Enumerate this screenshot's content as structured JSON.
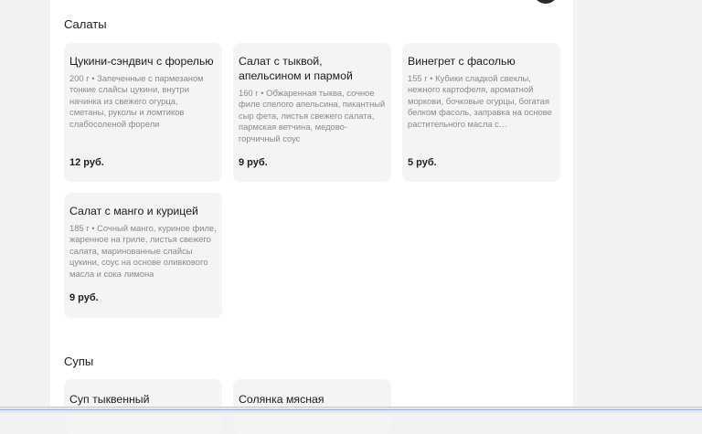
{
  "sections": [
    {
      "title": "Салаты",
      "items": [
        {
          "name": "Цукини-сэндвич с форелью",
          "desc": "200 г • Запеченные с пармезаном тонкие слайсы цукини, внутри начинка из свежего огурца, сметаны, руколы и ломтиков слабосоленой форели",
          "price": "12 руб."
        },
        {
          "name": "Салат с тыквой, апельсином и пармой",
          "desc": "160 г • Обжаренная тыква, сочное филе спелого апельсина, пикантный сыр фета, листья свежего салата, пармская ветчина, медово-горчичный соус",
          "price": "9 руб."
        },
        {
          "name": "Винегрет с фасолью",
          "desc": "155 г • Кубики сладкой свеклы, нежного картофеля, ароматной моркови, бочковые огурцы, богатая белком фасоль, заправка на основе растительного масла с…",
          "price": "5 руб."
        },
        {
          "name": "Салат с манго и курицей",
          "desc": "185 г • Сочный манго, куриное филе, жаренное на гриле, листья свежего салата, маринованные слайсы цукини, соус на основе оливкового масла и сока лимона",
          "price": "9 руб."
        }
      ]
    },
    {
      "title": "Супы",
      "items": [
        {
          "name": "Суп тыквенный"
        },
        {
          "name": "Солянка мясная"
        }
      ]
    }
  ]
}
